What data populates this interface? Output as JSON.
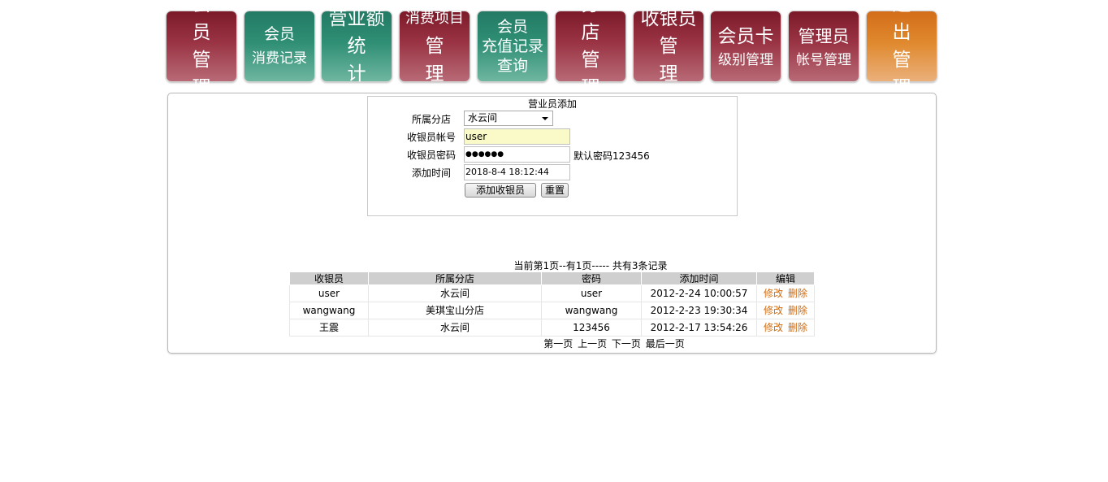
{
  "nav": [
    {
      "line1": "会 员",
      "line2": "管 理",
      "style": "red"
    },
    {
      "line1": "会员",
      "line2": "消费记录",
      "style": "green"
    },
    {
      "line1": "营业额",
      "line2": "统 计",
      "style": "green"
    },
    {
      "line1": "消费项目",
      "line2": "管 理",
      "style": "red"
    },
    {
      "line1": "会员",
      "line2": "充值记录",
      "line3": "查询",
      "style": "green"
    },
    {
      "line1": "分 店",
      "line2": "管 理",
      "style": "red"
    },
    {
      "line1": "收银员",
      "line2": "管 理",
      "style": "red"
    },
    {
      "line1": "会员卡",
      "line2": "级别管理",
      "style": "red"
    },
    {
      "line1": "管理员",
      "line2": "帐号管理",
      "style": "red"
    },
    {
      "line1": "退 出",
      "line2": "管 理",
      "style": "orange"
    }
  ],
  "form": {
    "title": "营业员添加",
    "branch_label": "所属分店",
    "branch_value": "水云间",
    "account_label": "收银员帐号",
    "account_value": "user",
    "password_label": "收银员密码",
    "password_mask": "●●●●●●",
    "password_hint": "默认密码123456",
    "time_label": "添加时间",
    "time_value": "2018-8-4 18:12:44",
    "add_button": "添加收银员",
    "reset_button": "重置"
  },
  "list": {
    "page_info": "当前第1页--有1页----- 共有3条记录",
    "headers": [
      "收银员",
      "所属分店",
      "密码",
      "添加时间",
      "编辑"
    ],
    "rows": [
      {
        "cashier": "user",
        "branch": "水云间",
        "password": "user",
        "time": "2012-2-24 10:00:57",
        "edit": "修改",
        "delete": "删除"
      },
      {
        "cashier": "wangwang",
        "branch": "美琪宝山分店",
        "password": "wangwang",
        "time": "2012-2-23 19:30:34",
        "edit": "修改",
        "delete": "删除"
      },
      {
        "cashier": "王震",
        "branch": "水云间",
        "password": "123456",
        "time": "2012-2-17 13:54:26",
        "edit": "修改",
        "delete": "删除"
      }
    ],
    "pager": {
      "first": "第一页",
      "prev": "上一页",
      "next": "下一页",
      "last": "最后一页"
    }
  },
  "colors": {
    "red": "#8e2b3b",
    "green": "#2f8f75",
    "orange": "#e0892e",
    "link": "#d06a0c"
  }
}
